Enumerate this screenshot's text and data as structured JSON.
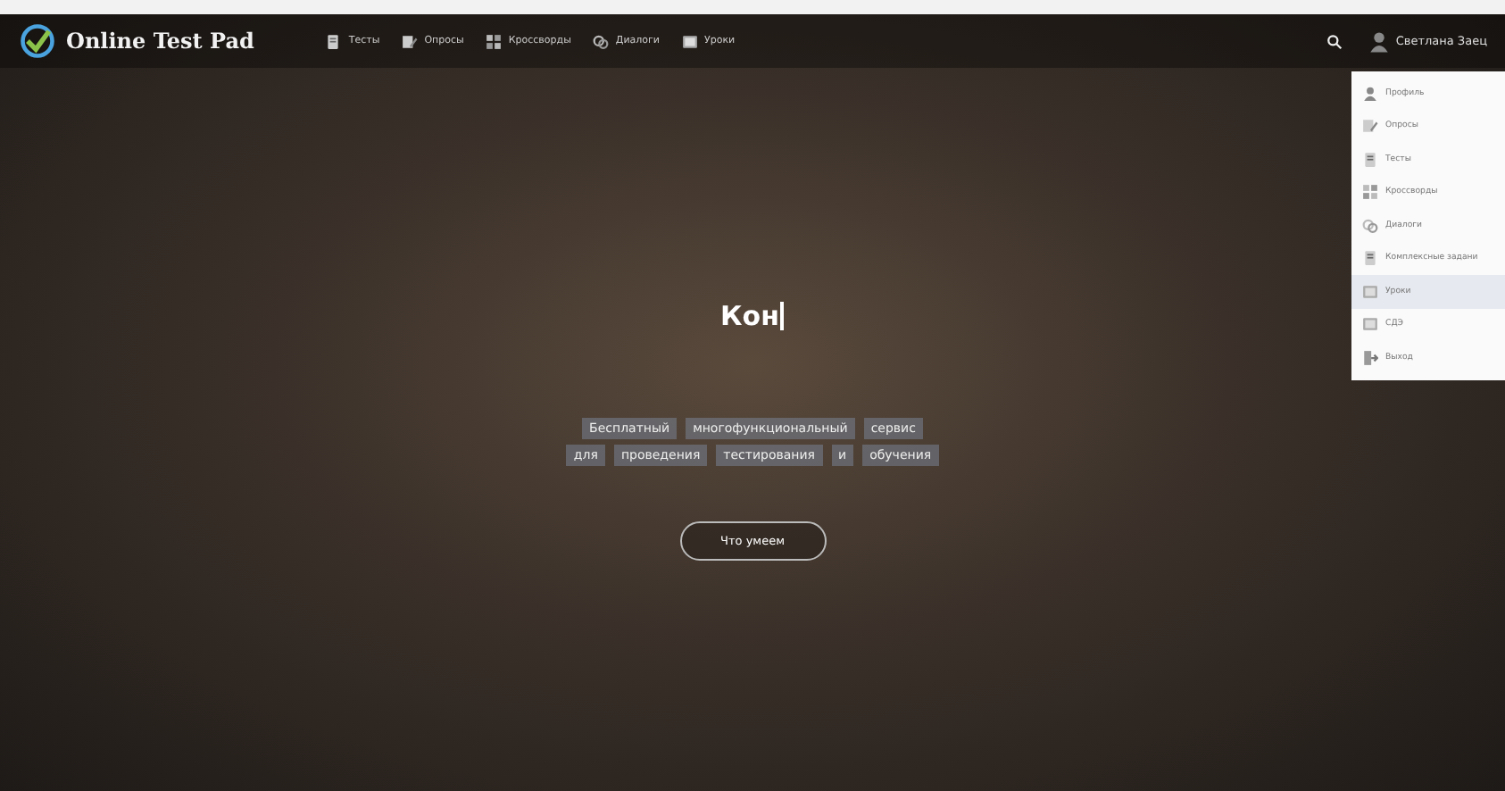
{
  "header": {
    "logo": "Online Test Pad",
    "nav": [
      {
        "label": "Тесты",
        "kind": "doc"
      },
      {
        "label": "Опросы",
        "kind": "edit"
      },
      {
        "label": "Кроссворды",
        "kind": "grid"
      },
      {
        "label": "Диалоги",
        "kind": "chat"
      },
      {
        "label": "Уроки",
        "kind": "board"
      }
    ],
    "user": "Светлана Заец"
  },
  "user_menu": [
    {
      "label": "Профиль",
      "kind": "person",
      "selected": false
    },
    {
      "label": "Опросы",
      "kind": "edit",
      "selected": false
    },
    {
      "label": "Тесты",
      "kind": "doc",
      "selected": false
    },
    {
      "label": "Кроссворды",
      "kind": "grid",
      "selected": false
    },
    {
      "label": "Диалоги",
      "kind": "chat",
      "selected": false
    },
    {
      "label": "Комплексные задани",
      "kind": "doc",
      "selected": false
    },
    {
      "label": "Уроки",
      "kind": "board",
      "selected": true
    },
    {
      "label": "СДЭ",
      "kind": "board",
      "selected": false
    },
    {
      "label": "Выход",
      "kind": "exit",
      "selected": false
    }
  ],
  "hero": {
    "typed_title": "Кон",
    "tagline": [
      [
        "Бесплатный",
        "многофункциональный",
        "сервис"
      ],
      [
        "для",
        "проведения",
        "тестирования",
        "и",
        "обучения"
      ]
    ],
    "button": "Что умеем"
  }
}
